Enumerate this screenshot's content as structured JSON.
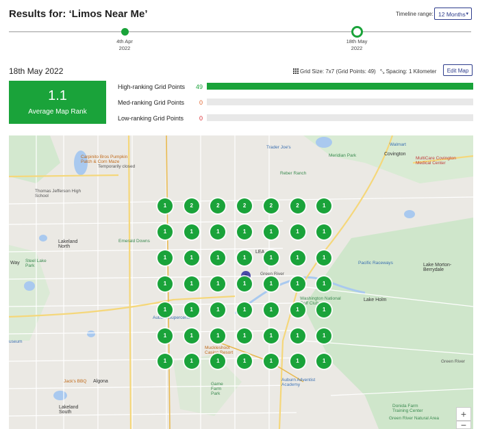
{
  "header": {
    "title": "Results for: ‘Limos Near Me’",
    "timeline_range_label": "Timeline range:",
    "timeline_range_value": "12 Months"
  },
  "timeline": {
    "points": [
      {
        "date": "4th Apr",
        "year": "2022",
        "selected": false
      },
      {
        "date": "18th May",
        "year": "2022",
        "selected": true
      }
    ]
  },
  "report": {
    "date": "18th May 2022",
    "grid_size": "Grid Size: 7x7 (Grid Points: 49)",
    "spacing": "Spacing: 1 Kilometer",
    "edit_map": "Edit Map",
    "average_rank": "1.1",
    "average_label": "Average Map Rank",
    "stats": [
      {
        "label": "High-ranking Grid Points",
        "count": "49",
        "color": "#1aa33a",
        "fraction": 1.0
      },
      {
        "label": "Med-ranking Grid Points",
        "count": "0",
        "color": "#e0622a",
        "fraction": 0
      },
      {
        "label": "Low-ranking Grid Points",
        "count": "0",
        "color": "#d9262c",
        "fraction": 0
      }
    ]
  },
  "map": {
    "grid": [
      [
        "1",
        "2",
        "2",
        "2",
        "2",
        "2",
        "1"
      ],
      [
        "1",
        "1",
        "1",
        "1",
        "1",
        "1",
        "1"
      ],
      [
        "1",
        "1",
        "1",
        "1",
        "1",
        "1",
        "1"
      ],
      [
        "1",
        "1",
        "1",
        "1",
        "1",
        "1",
        "1"
      ],
      [
        "1",
        "1",
        "1",
        "1",
        "1",
        "1",
        "1"
      ],
      [
        "1",
        "1",
        "1",
        "1",
        "1",
        "1",
        "1"
      ],
      [
        "1",
        "1",
        "1",
        "1",
        "1",
        "1",
        "1"
      ]
    ],
    "labels": {
      "trader_joes": "Trader Joe's",
      "walmart": "Walmart",
      "covington": "Covington",
      "multicare": "MultiCare Covington Medical Center",
      "carpinito": "Carpinito Bros Pumpkin Patch & Corn Maze",
      "carpinito_sub": "Temporarily closed",
      "meridian": "Meridian Park",
      "jefferson": "Thomas Jefferson High School",
      "reber": "Reber Ranch",
      "emerald": "Emerald Downs",
      "lakeland": "Lakeland North",
      "steel_lake": "Steel Lake Park",
      "pacific_raceways": "Pacific Raceways",
      "lake_mb": "Lake Morton-Berrydale",
      "green_river": "Green River",
      "washington_national": "Washington National Golf Club",
      "lake_holm": "Lake Holm",
      "auburn_supercenter": "Auburn Supercenter",
      "muckleshoot": "Muckleshoot Casino Resort",
      "green_river_2": "Green River",
      "jacks": "Jack's BBQ",
      "algona": "Algona",
      "game_farm": "Game Farm Park",
      "auburn_adventist": "Auburn Adventist Academy",
      "lakeland_south": "Lakeland South",
      "donida": "Donida Farm Training Center",
      "green_river_natural": "Green River Natural Area",
      "museum": "useum",
      "way": "Way",
      "lea": "LEA"
    },
    "zoom_in": "+",
    "zoom_out": "−"
  }
}
